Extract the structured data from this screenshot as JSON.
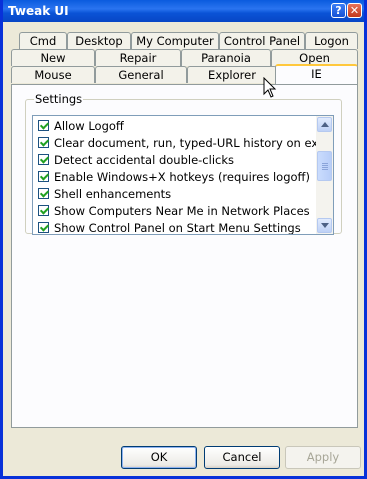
{
  "window": {
    "title": "Tweak UI",
    "help_glyph": "?",
    "close_glyph": "✕"
  },
  "tabs_row1": [
    "Cmd",
    "Desktop",
    "My Computer",
    "Control Panel",
    "Logon"
  ],
  "tabs_row2": [
    "New",
    "Repair",
    "Paranoia",
    "Open"
  ],
  "tabs_row3": [
    "Mouse",
    "General",
    "Explorer",
    "IE"
  ],
  "active_tab": "IE",
  "settings": {
    "group_label": "Settings",
    "items": [
      {
        "label": "Allow Logoff",
        "checked": true
      },
      {
        "label": "Clear document, run, typed-URL history on exit",
        "checked": true
      },
      {
        "label": "Detect accidental double-clicks",
        "checked": true
      },
      {
        "label": "Enable Windows+X hotkeys (requires logoff)",
        "checked": true
      },
      {
        "label": "Shell enhancements",
        "checked": true
      },
      {
        "label": "Show Computers Near Me in Network Places",
        "checked": true
      },
      {
        "label": "Show Control Panel on Start Menu Settings",
        "checked": true
      }
    ]
  },
  "buttons": {
    "ok": "OK",
    "cancel": "Cancel",
    "apply": "Apply"
  },
  "colors": {
    "title_bar": "#0a5bde",
    "window_face": "#ece9d8",
    "active_tab_accent": "#ffc83c",
    "checkmark": "#21a121"
  }
}
